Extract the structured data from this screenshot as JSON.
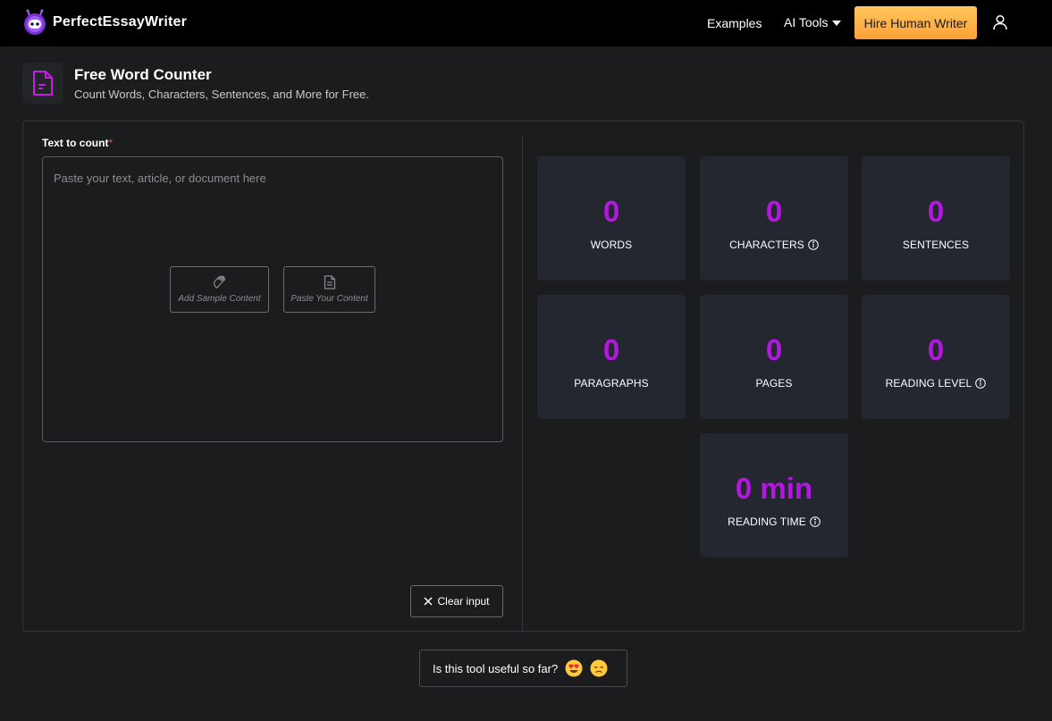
{
  "nav": {
    "logo_text": "PerfectEssayWriter",
    "examples_label": "Examples",
    "ai_tools_label": "AI Tools",
    "hire_button_label": "Hire Human Writer"
  },
  "header": {
    "title": "Free Word Counter",
    "subtitle": "Count Words, Characters, Sentences, and More for Free."
  },
  "input": {
    "label": "Text to count",
    "required_mark": "*",
    "placeholder": "Paste your text, article, or document here",
    "add_sample_label": "Add Sample Content",
    "paste_label": "Paste Your Content",
    "clear_label": "Clear input"
  },
  "stats": [
    {
      "value": "0",
      "label": "WORDS",
      "info": false
    },
    {
      "value": "0",
      "label": "CHARACTERS",
      "info": true
    },
    {
      "value": "0",
      "label": "SENTENCES",
      "info": false
    },
    {
      "value": "0",
      "label": "PARAGRAPHS",
      "info": false
    },
    {
      "value": "0",
      "label": "PAGES",
      "info": false
    },
    {
      "value": "0",
      "label": "READING LEVEL",
      "info": true
    },
    {
      "value": "0 min",
      "label": "READING TIME",
      "info": true
    }
  ],
  "feedback": {
    "question": "Is this tool useful so far?"
  },
  "colors": {
    "accent": "#b317e0",
    "cta_top": "#ffc75a",
    "cta_bottom": "#ff9f3a",
    "background": "#1b1c1e",
    "card": "#242630"
  }
}
